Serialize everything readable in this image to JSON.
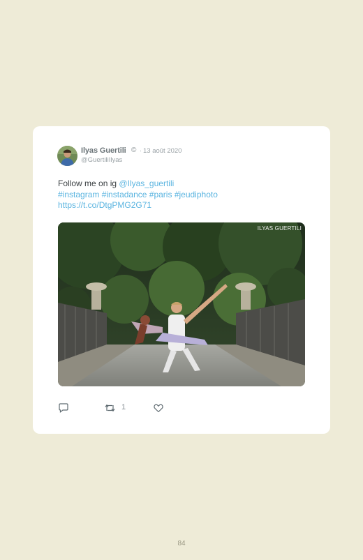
{
  "tweet": {
    "author_name": "Ilyas Guertili",
    "verified_glyph": "©",
    "separator": "·",
    "date": "13 août 2020",
    "handle": "@GuertiliIlyas",
    "text_lead": "Follow me on ig",
    "mention": "@Ilyas_guertili",
    "hashtags": [
      "#instagram",
      "#instadance",
      "#paris",
      "#jeudiphoto"
    ],
    "url": "https://t.co/DtgPMG2G71",
    "image_watermark": "ILYAS GUERTILI",
    "image_alt": "Two dancers posing on a tree-lined bridge",
    "actions": {
      "reply_icon": "reply-icon",
      "retweet_icon": "retweet-icon",
      "retweet_count": "1",
      "like_icon": "heart-icon"
    }
  },
  "colors": {
    "page_background": "#eeebd7",
    "card_background": "#ffffff",
    "link": "#5ab4e0",
    "text": "#3a3f42",
    "muted": "#9aa2a6"
  },
  "page_number": "84"
}
